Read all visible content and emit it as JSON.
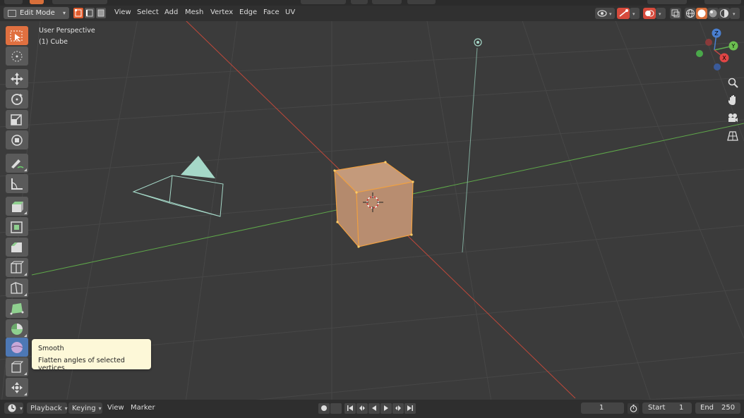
{
  "header": {
    "mode": "Edit Mode",
    "menus": [
      "View",
      "Select",
      "Add",
      "Mesh",
      "Vertex",
      "Edge",
      "Face",
      "UV"
    ]
  },
  "viewport": {
    "view_name": "User Perspective",
    "object_name": "(1) Cube"
  },
  "tooltip": {
    "title": "Smooth",
    "description": "Flatten angles of selected vertices."
  },
  "gizmo": {
    "x": "X",
    "y": "Y",
    "z": "Z"
  },
  "timeline": {
    "playback": "Playback",
    "keying": "Keying",
    "view": "View",
    "marker": "Marker",
    "current_frame": "1",
    "start_label": "Start",
    "start_value": "1",
    "end_label": "End",
    "end_value": "250"
  },
  "colors": {
    "x_axis": "#c0483a",
    "y_axis": "#5fa84a",
    "active_tool": "#e07040",
    "cube_face": "#b88d70",
    "cube_edge": "#f0a040",
    "tooltip_bg": "#fdf8d8"
  }
}
